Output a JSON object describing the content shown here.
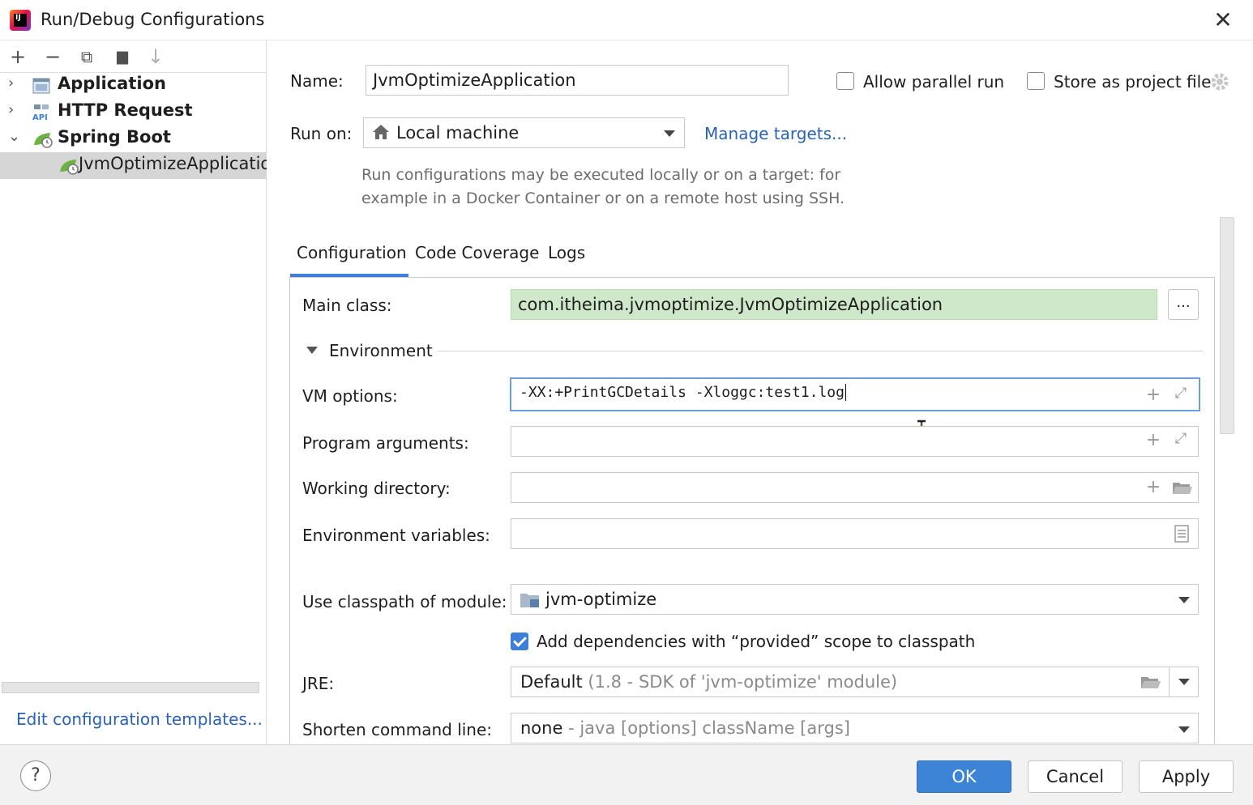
{
  "window": {
    "title": "Run/Debug Configurations",
    "logo_text": "IJ"
  },
  "toolbar": {
    "add": "+",
    "remove": "−",
    "copy": "⧉",
    "folder": "▆",
    "sort": "↓"
  },
  "tree": {
    "items": [
      {
        "label": "Application",
        "chevron": "›"
      },
      {
        "label": "HTTP Request",
        "chevron": "›"
      },
      {
        "label": "Spring Boot",
        "chevron": "⌄"
      },
      {
        "label": "JvmOptimizeApplication"
      }
    ]
  },
  "left_footer": {
    "edit_templates": "Edit configuration templates..."
  },
  "header": {
    "name_label": "Name:",
    "name_value": "JvmOptimizeApplication",
    "allow_parallel_label": "Allow parallel run",
    "allow_parallel_checked": false,
    "store_project_label": "Store as project file",
    "store_project_checked": false,
    "run_on_label": "Run on:",
    "run_on_value": "Local machine",
    "manage_targets": "Manage targets...",
    "help_line1": "Run configurations may be executed locally or on a target: for",
    "help_line2": "example in a Docker Container or on a remote host using SSH."
  },
  "tabs": [
    {
      "label": "Configuration",
      "active": true
    },
    {
      "label": "Code Coverage",
      "active": false
    },
    {
      "label": "Logs",
      "active": false
    }
  ],
  "config": {
    "main_class_label": "Main class:",
    "main_class_value": "com.itheima.jvmoptimize.JvmOptimizeApplication",
    "browse_label": "...",
    "environment_label": "Environment",
    "vm_options_label": "VM options:",
    "vm_options_value": "-XX:+PrintGCDetails -Xloggc:test1.log",
    "program_args_label": "Program arguments:",
    "program_args_value": "",
    "working_dir_label": "Working directory:",
    "working_dir_value": "",
    "env_vars_label": "Environment variables:",
    "env_vars_value": "",
    "classpath_label": "Use classpath of module:",
    "classpath_value": "jvm-optimize",
    "add_deps_label": "Add dependencies with “provided” scope to classpath",
    "add_deps_checked": true,
    "jre_label": "JRE:",
    "jre_value": "Default",
    "jre_hint": "(1.8 - SDK of 'jvm-optimize' module)",
    "shorten_label": "Shorten command line:",
    "shorten_value": "none",
    "shorten_hint": "- java [options] className [args]"
  },
  "buttons": {
    "ok": "OK",
    "cancel": "Cancel",
    "apply": "Apply",
    "help": "?"
  },
  "colors": {
    "accent": "#3d7ed8",
    "link": "#2a62b5",
    "main_class_bg": "#cfe8c9",
    "selected_row": "#d6d6d6"
  }
}
